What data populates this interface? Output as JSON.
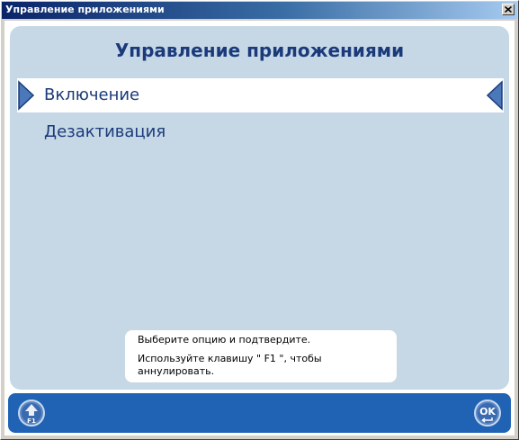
{
  "window": {
    "title": "Управление приложениями",
    "close_glyph": "×"
  },
  "header": {
    "title": "Управление приложениями"
  },
  "menu": {
    "items": [
      {
        "label": "Включение",
        "selected": true
      },
      {
        "label": "Дезактивация",
        "selected": false
      }
    ]
  },
  "hint": {
    "line1": "Выберите опцию и подтвердите.",
    "line2": "Используйте клавишу \" F1 \", чтобы",
    "line3": "аннулировать."
  },
  "bottom_bar": {
    "back_button": {
      "icon": "up-arrow-icon",
      "key_label": "F1"
    },
    "ok_button": {
      "icon": "ok-icon",
      "label": "OK"
    }
  },
  "colors": {
    "panel": "#c6d8e6",
    "accent": "#1b3a7a",
    "bar": "#2063b5"
  }
}
